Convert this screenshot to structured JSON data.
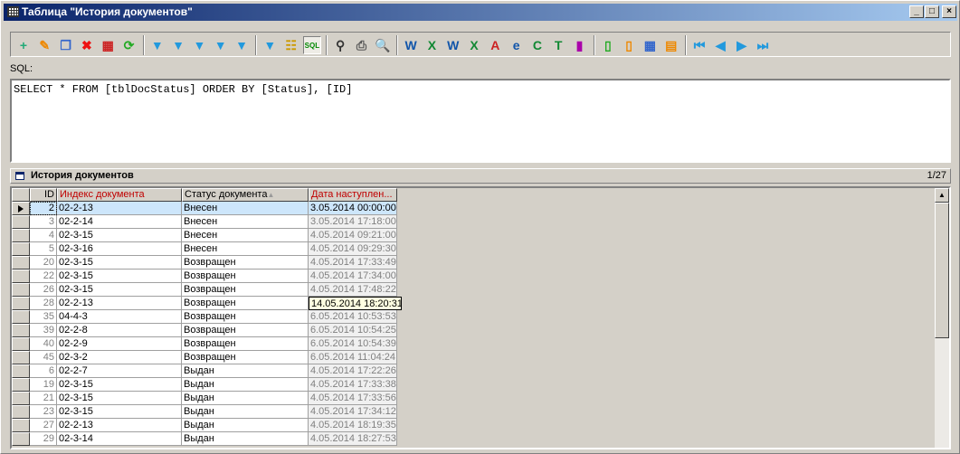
{
  "window": {
    "title": "Таблица \"История документов\"",
    "min": "_",
    "max": "□",
    "close": "×"
  },
  "toolbar": {
    "groups": [
      [
        "new-record",
        "edit",
        "copy",
        "delete",
        "delete-all",
        "refresh"
      ],
      [
        "filter-add",
        "filter-remove",
        "filter-remove-all",
        "filter-open",
        "filter-save"
      ],
      [
        "view-filter",
        "tree-view",
        "sql-view"
      ],
      [
        "find",
        "print",
        "print-preview"
      ],
      [
        "export-word",
        "export-excel",
        "export-word-link",
        "export-excel-link",
        "export-pdf",
        "export-html",
        "export-csv",
        "export-txt",
        "chart"
      ],
      [
        "add-column",
        "column-settings",
        "grid-settings",
        "table-settings"
      ],
      [
        "first-record",
        "prev-record",
        "next-record",
        "last-record"
      ]
    ],
    "active": "sql-view"
  },
  "sql": {
    "label": "SQL:",
    "query": "SELECT * FROM [tblDocStatus] ORDER BY [Status], [ID]"
  },
  "section": {
    "title": "История документов",
    "counter": "1/27"
  },
  "grid": {
    "columns": [
      "ID",
      "Индекс документа",
      "Статус документа",
      "Дата наступлен..."
    ],
    "sort_indicator": "▲",
    "rows": [
      [
        "2",
        "02-2-13",
        "Внесен",
        "3.05.2014 00:00:00"
      ],
      [
        "3",
        "02-2-14",
        "Внесен",
        "3.05.2014 17:18:00"
      ],
      [
        "4",
        "02-3-15",
        "Внесен",
        "4.05.2014 09:21:00"
      ],
      [
        "5",
        "02-3-16",
        "Внесен",
        "4.05.2014 09:29:30"
      ],
      [
        "20",
        "02-3-15",
        "Возвращен",
        "4.05.2014 17:33:49"
      ],
      [
        "22",
        "02-3-15",
        "Возвращен",
        "4.05.2014 17:34:00"
      ],
      [
        "26",
        "02-3-15",
        "Возвращен",
        "4.05.2014 17:48:22"
      ],
      [
        "28",
        "02-2-13",
        "Возвращен",
        "14.05.2014 18:20:31"
      ],
      [
        "35",
        "04-4-3",
        "Возвращен",
        "6.05.2014 10:53:53"
      ],
      [
        "39",
        "02-2-8",
        "Возвращен",
        "6.05.2014 10:54:25"
      ],
      [
        "40",
        "02-2-9",
        "Возвращен",
        "6.05.2014 10:54:39"
      ],
      [
        "45",
        "02-3-2",
        "Возвращен",
        "6.05.2014 11:04:24"
      ],
      [
        "6",
        "02-2-7",
        "Выдан",
        "4.05.2014 17:22:26"
      ],
      [
        "19",
        "02-3-15",
        "Выдан",
        "4.05.2014 17:33:38"
      ],
      [
        "21",
        "02-3-15",
        "Выдан",
        "4.05.2014 17:33:56"
      ],
      [
        "23",
        "02-3-15",
        "Выдан",
        "4.05.2014 17:34:12"
      ],
      [
        "27",
        "02-2-13",
        "Выдан",
        "4.05.2014 18:19:35"
      ],
      [
        "29",
        "02-3-14",
        "Выдан",
        "4.05.2014 18:27:53"
      ]
    ],
    "selected_row": 0,
    "editing_row": 7
  }
}
